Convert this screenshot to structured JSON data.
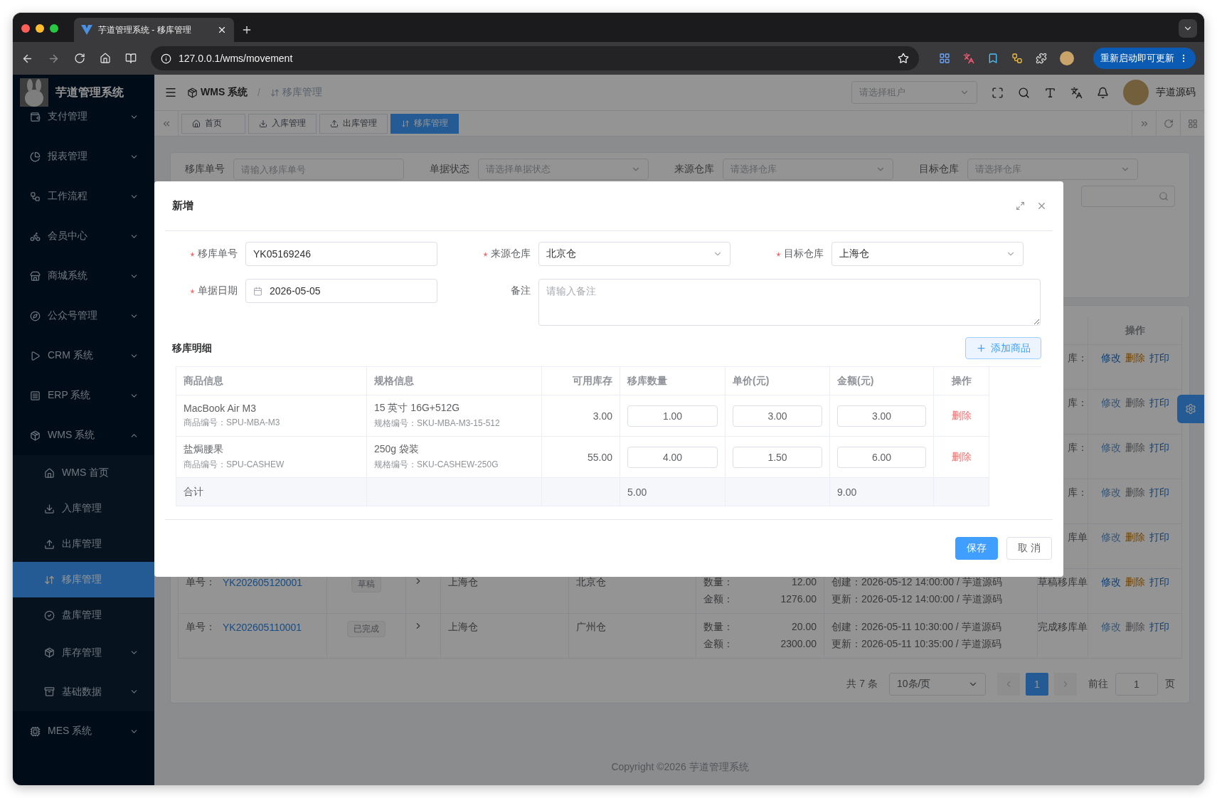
{
  "browser": {
    "tab_title": "芋道管理系统 - 移库管理",
    "url": "127.0.0.1/wms/movement",
    "update_button": "重新启动即可更新"
  },
  "sidebar": {
    "title": "芋道管理系统",
    "items": [
      {
        "label": "支付管理",
        "expanded": false
      },
      {
        "label": "报表管理",
        "expanded": false
      },
      {
        "label": "工作流程",
        "expanded": false
      },
      {
        "label": "会员中心",
        "expanded": false
      },
      {
        "label": "商城系统",
        "expanded": false
      },
      {
        "label": "公众号管理",
        "expanded": false
      },
      {
        "label": "CRM 系统",
        "expanded": false
      },
      {
        "label": "ERP 系统",
        "expanded": false
      },
      {
        "label": "WMS 系统",
        "expanded": true,
        "children": [
          {
            "label": "WMS 首页",
            "kind": "page",
            "selected": false
          },
          {
            "label": "入库管理",
            "kind": "page",
            "selected": false
          },
          {
            "label": "出库管理",
            "kind": "page",
            "selected": false
          },
          {
            "label": "移库管理",
            "kind": "page",
            "selected": true
          },
          {
            "label": "盘库管理",
            "kind": "page",
            "selected": false
          },
          {
            "label": "库存管理",
            "kind": "group",
            "selected": false
          },
          {
            "label": "基础数据",
            "kind": "group",
            "selected": false
          }
        ]
      },
      {
        "label": "MES 系统",
        "expanded": false
      }
    ]
  },
  "header": {
    "breadcrumb": [
      "WMS 系统",
      "移库管理"
    ],
    "breadcrumb_separator": "/",
    "tenant_placeholder": "请选择租户",
    "user": "芋道源码"
  },
  "tags": [
    {
      "label": "首页",
      "selected": false
    },
    {
      "label": "入库管理",
      "selected": false
    },
    {
      "label": "出库管理",
      "selected": false
    },
    {
      "label": "移库管理",
      "selected": true
    }
  ],
  "filters": [
    {
      "label": "移库单号",
      "kind": "input",
      "placeholder": "请输入移库单号"
    },
    {
      "label": "单据状态",
      "kind": "select",
      "placeholder": "请选择单据状态"
    },
    {
      "label": "来源仓库",
      "kind": "select",
      "placeholder": "请选择仓库"
    },
    {
      "label": "目标仓库",
      "kind": "select",
      "placeholder": "请选择仓库"
    }
  ],
  "list_table": {
    "action_header": "操作",
    "rows": [
      {
        "remark": "库：",
        "actions": [
          {
            "label": "修改",
            "kind": "edit",
            "enabled": true
          },
          {
            "label": "删除",
            "kind": "delete",
            "enabled": true
          },
          {
            "label": "打印",
            "kind": "print",
            "enabled": true
          }
        ]
      },
      {
        "remark": "库：",
        "actions": [
          {
            "label": "修改",
            "kind": "edit",
            "enabled": false
          },
          {
            "label": "删除",
            "kind": "delete",
            "enabled": false
          },
          {
            "label": "打印",
            "kind": "print",
            "enabled": true
          }
        ]
      },
      {
        "remark": "库：",
        "actions": [
          {
            "label": "修改",
            "kind": "edit",
            "enabled": false
          },
          {
            "label": "删除",
            "kind": "delete",
            "enabled": false
          },
          {
            "label": "打印",
            "kind": "print",
            "enabled": true
          }
        ]
      },
      {
        "remark": "库：",
        "actions": [
          {
            "label": "修改",
            "kind": "edit",
            "enabled": false
          },
          {
            "label": "删除",
            "kind": "delete",
            "enabled": false
          },
          {
            "label": "打印",
            "kind": "print",
            "enabled": true
          }
        ]
      },
      {
        "remark": "库单",
        "actions": [
          {
            "label": "修改",
            "kind": "edit",
            "enabled": false
          },
          {
            "label": "删除",
            "kind": "delete",
            "enabled": true
          },
          {
            "label": "打印",
            "kind": "print",
            "enabled": true
          }
        ]
      },
      {
        "number_label": "单号：",
        "number": "YK202605120001",
        "status": "草稿",
        "from": "上海仓",
        "to": "北京仓",
        "qty_label": "数量：",
        "qty": "12.00",
        "amount_label": "金额：",
        "amount": "1276.00",
        "created": "创建：2026-05-12 14:00:00 / 芋道源码",
        "updated": "更新：2026-05-12 14:00:00 / 芋道源码",
        "remark": "草稿移库单",
        "actions": [
          {
            "label": "修改",
            "kind": "edit",
            "enabled": true
          },
          {
            "label": "删除",
            "kind": "delete",
            "enabled": true
          },
          {
            "label": "打印",
            "kind": "print",
            "enabled": true
          }
        ]
      },
      {
        "number_label": "单号：",
        "number": "YK202605110001",
        "status": "已完成",
        "from": "上海仓",
        "to": "广州仓",
        "qty_label": "数量：",
        "qty": "20.00",
        "amount_label": "金额：",
        "amount": "2300.00",
        "created": "创建：2026-05-11 10:30:00 / 芋道源码",
        "updated": "更新：2026-05-11 10:35:00 / 芋道源码",
        "remark": "完成移库单",
        "actions": [
          {
            "label": "修改",
            "kind": "edit",
            "enabled": false
          },
          {
            "label": "删除",
            "kind": "delete",
            "enabled": false
          },
          {
            "label": "打印",
            "kind": "print",
            "enabled": true
          }
        ]
      }
    ]
  },
  "pagination": {
    "total": "共 7 条",
    "page_size": "10条/页",
    "pages": [
      {
        "label": "1",
        "selected": true
      }
    ],
    "goto_label": "前往",
    "goto_value": "1",
    "page_suffix": "页"
  },
  "footer": "Copyright ©2026 芋道管理系统",
  "modal": {
    "title": "新增",
    "fields": [
      {
        "label": "移库单号",
        "required": true,
        "kind": "input",
        "value": "YK05169246"
      },
      {
        "label": "来源仓库",
        "required": true,
        "kind": "select",
        "value": "北京仓"
      },
      {
        "label": "目标仓库",
        "required": true,
        "kind": "select",
        "value": "上海仓"
      },
      {
        "label": "单据日期",
        "required": true,
        "kind": "date",
        "value": "2026-05-05"
      },
      {
        "label": "备注",
        "required": false,
        "kind": "textarea",
        "placeholder": "请输入备注"
      }
    ],
    "detail_title": "移库明细",
    "add_button": "添加商品",
    "columns": [
      "商品信息",
      "规格信息",
      "可用库存",
      "移库数量",
      "单价(元)",
      "金额(元)",
      "操作"
    ],
    "rows": [
      {
        "name": "MacBook Air M3",
        "code": "商品编号：SPU-MBA-M3",
        "spec": "15 英寸 16G+512G",
        "spec_code": "规格编号：SKU-MBA-M3-15-512",
        "stock": "3.00",
        "qty": "1.00",
        "price": "3.00",
        "amount": "3.00",
        "action": "删除"
      },
      {
        "name": "盐焗腰果",
        "code": "商品编号：SPU-CASHEW",
        "spec": "250g 袋装",
        "spec_code": "规格编号：SKU-CASHEW-250G",
        "stock": "55.00",
        "qty": "4.00",
        "price": "1.50",
        "amount": "6.00",
        "action": "删除"
      }
    ],
    "total": {
      "label": "合计",
      "qty": "5.00",
      "amount": "9.00"
    },
    "save_button": "保存",
    "cancel_button": "取 消"
  }
}
